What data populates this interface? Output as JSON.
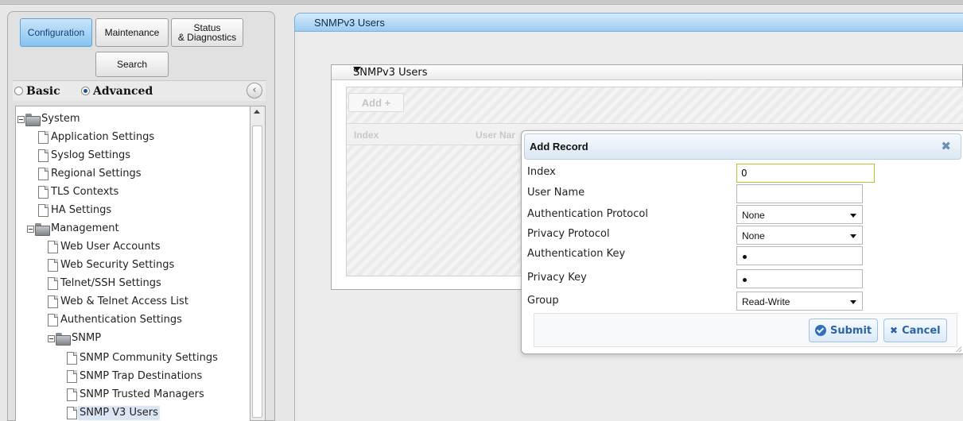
{
  "nav": {
    "tabs": [
      "Configuration",
      "Maintenance",
      "Status\n& Diagnostics"
    ],
    "active_tab": "Configuration",
    "search_label": "Search",
    "modes": [
      "Basic",
      "Advanced"
    ],
    "selected_mode": "Advanced",
    "collapse_icon": "chevron-left-icon"
  },
  "tree": {
    "system": "System",
    "system_items": [
      "Application Settings",
      "Syslog Settings",
      "Regional Settings",
      "TLS Contexts",
      "HA Settings"
    ],
    "management": "Management",
    "management_items": [
      "Web User Accounts",
      "Web Security Settings",
      "Telnet/SSH Settings",
      "Web & Telnet Access List",
      "Authentication Settings"
    ],
    "snmp": "SNMP",
    "snmp_items": [
      "SNMP Community Settings",
      "SNMP Trap Destinations",
      "SNMP Trusted Managers",
      "SNMP V3 Users"
    ],
    "selected": "SNMP V3 Users"
  },
  "page": {
    "title": "SNMPv3 Users",
    "section_title": "SNMPv3 Users",
    "add_label": "Add +",
    "columns": [
      "Index",
      "User Nar"
    ]
  },
  "dialog": {
    "title": "Add Record",
    "close_icon": "close-icon",
    "fields": {
      "index": {
        "label": "Index",
        "value": "0"
      },
      "user_name": {
        "label": "User Name",
        "value": ""
      },
      "auth_protocol": {
        "label": "Authentication Protocol",
        "value": "None"
      },
      "privacy_protocol": {
        "label": "Privacy Protocol",
        "value": "None"
      },
      "auth_key": {
        "label": "Authentication Key",
        "value": "•"
      },
      "privacy_key": {
        "label": "Privacy Key",
        "value": "•"
      },
      "group": {
        "label": "Group",
        "value": "Read-Write"
      }
    },
    "submit_label": "Submit",
    "cancel_label": "Cancel"
  },
  "colors": {
    "accent": "#86c3ee",
    "title_bar": "#9ccbef",
    "button_text": "#2c64a4"
  }
}
